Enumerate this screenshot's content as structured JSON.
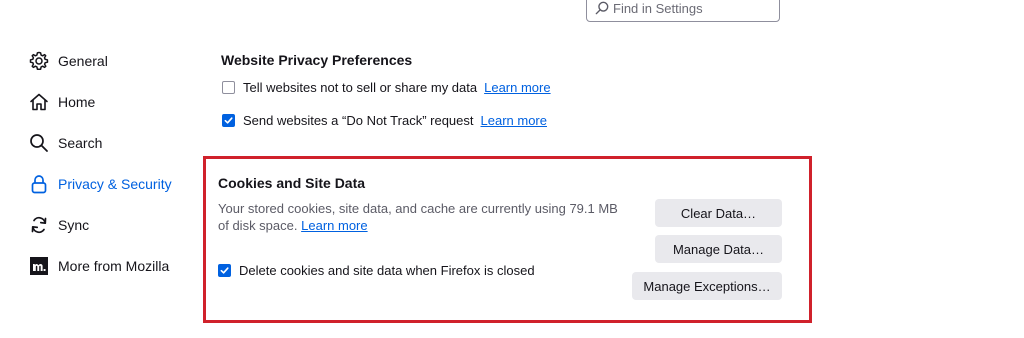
{
  "search": {
    "placeholder": "Find in Settings"
  },
  "sidebar": {
    "items": [
      {
        "label": "General",
        "icon": "gear-icon"
      },
      {
        "label": "Home",
        "icon": "home-icon"
      },
      {
        "label": "Search",
        "icon": "search-icon"
      },
      {
        "label": "Privacy & Security",
        "icon": "lock-icon",
        "active": true
      },
      {
        "label": "Sync",
        "icon": "sync-icon"
      },
      {
        "label": "More from Mozilla",
        "icon": "mozilla-icon"
      }
    ]
  },
  "privacy_prefs": {
    "title": "Website Privacy Preferences",
    "options": [
      {
        "label": "Tell websites not to sell or share my data",
        "checked": false,
        "link": "Learn more"
      },
      {
        "label": "Send websites a “Do Not Track” request",
        "checked": true,
        "link": "Learn more"
      }
    ]
  },
  "cookies": {
    "title": "Cookies and Site Data",
    "description": "Your stored cookies, site data, and cache are currently using 79.1 MB of disk space.",
    "learn_more": "Learn more",
    "delete_on_close": {
      "label": "Delete cookies and site data when Firefox is closed",
      "checked": true
    },
    "buttons": {
      "clear": "Clear Data…",
      "manage": "Manage Data…",
      "exceptions": "Manage Exceptions…"
    }
  },
  "colors": {
    "accent": "#0061e0",
    "highlight": "#d0212b",
    "button_bg": "#e9e9ed"
  }
}
